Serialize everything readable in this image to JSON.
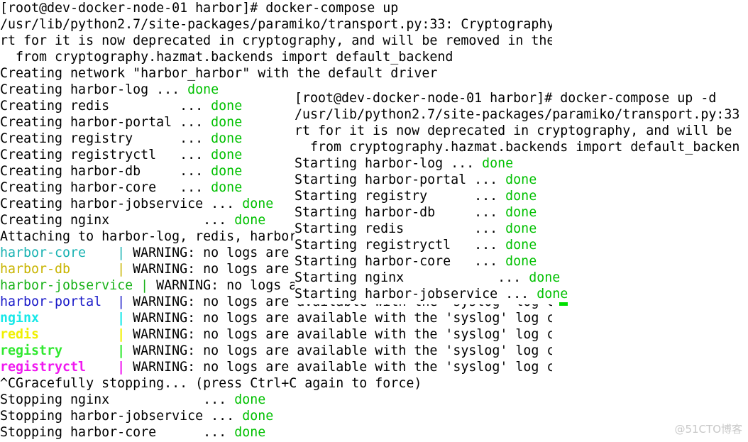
{
  "colors": {
    "default": "#000000",
    "done": "#00c000",
    "harbor-core": "#18b2b2",
    "harbor-db": "#c8b400",
    "harbor-jobservice": "#18b218",
    "harbor-portal": "#1818c8",
    "nginx": "#18e8e8",
    "redis": "#f0f000",
    "registry": "#30e830",
    "registryctl": "#f018f0"
  },
  "left_terminal": {
    "lines": [
      [
        {
          "t": "[root@dev-docker-node-01 harbor]# docker-compose up"
        }
      ],
      [
        {
          "t": "/usr/lib/python2.7/site-packages/paramiko/transport.py:33: Cryptography"
        }
      ],
      [
        {
          "t": "rt for it is now deprecated in cryptography, and will be removed in the"
        }
      ],
      [
        {
          "t": "  from cryptography.hazmat.backends import default_backend"
        }
      ],
      [
        {
          "t": "Creating network \"harbor_harbor\" with the default driver"
        }
      ],
      [
        {
          "t": "Creating harbor-log ... "
        },
        {
          "t": "done",
          "c": "done"
        }
      ],
      [
        {
          "t": "Creating redis         ... "
        },
        {
          "t": "done",
          "c": "done"
        }
      ],
      [
        {
          "t": "Creating harbor-portal ... "
        },
        {
          "t": "done",
          "c": "done"
        }
      ],
      [
        {
          "t": "Creating registry      ... "
        },
        {
          "t": "done",
          "c": "done"
        }
      ],
      [
        {
          "t": "Creating registryctl   ... "
        },
        {
          "t": "done",
          "c": "done"
        }
      ],
      [
        {
          "t": "Creating harbor-db     ... "
        },
        {
          "t": "done",
          "c": "done"
        }
      ],
      [
        {
          "t": "Creating harbor-core   ... "
        },
        {
          "t": "done",
          "c": "done"
        }
      ],
      [
        {
          "t": "Creating harbor-jobservice ... "
        },
        {
          "t": "done",
          "c": "done"
        }
      ],
      [
        {
          "t": "Creating nginx            ... "
        },
        {
          "t": "done",
          "c": "done"
        }
      ],
      [
        {
          "t": "Attaching to harbor-log, redis, harbor"
        }
      ],
      [
        {
          "t": "harbor-core    | ",
          "c": "harbor-core"
        },
        {
          "t": "WARNING: no logs are"
        }
      ],
      [
        {
          "t": "harbor-db      | ",
          "c": "harbor-db"
        },
        {
          "t": "WARNING: no logs are"
        }
      ],
      [
        {
          "t": "harbor-jobservice | ",
          "c": "harbor-jobservice"
        },
        {
          "t": "WARNING: no logs a"
        }
      ],
      [
        {
          "t": "harbor-portal  | ",
          "c": "harbor-portal"
        },
        {
          "t": "WARNING: no logs are available with the 'syslog' log c"
        }
      ],
      [
        {
          "t": "nginx          | ",
          "c": "nginx",
          "b": true
        },
        {
          "t": "WARNING: no logs are available with the 'syslog' log c"
        }
      ],
      [
        {
          "t": "redis          | ",
          "c": "redis",
          "b": true
        },
        {
          "t": "WARNING: no logs are available with the 'syslog' log c"
        }
      ],
      [
        {
          "t": "registry       | ",
          "c": "registry",
          "b": true
        },
        {
          "t": "WARNING: no logs are available with the 'syslog' log c"
        }
      ],
      [
        {
          "t": "registryctl    | ",
          "c": "registryctl",
          "b": true
        },
        {
          "t": "WARNING: no logs are available with the 'syslog' log c"
        }
      ],
      [
        {
          "t": "^CGracefully stopping... (press Ctrl+C again to force)"
        }
      ],
      [
        {
          "t": "Stopping nginx            ... "
        },
        {
          "t": "done",
          "c": "done"
        }
      ],
      [
        {
          "t": "Stopping harbor-jobservice ... "
        },
        {
          "t": "done",
          "c": "done"
        }
      ],
      [
        {
          "t": "Stopping harbor-core      ... "
        },
        {
          "t": "done",
          "c": "done"
        }
      ]
    ]
  },
  "right_terminal": {
    "lines": [
      [
        {
          "t": "[root@dev-docker-node-01 harbor]# docker-compose up -d"
        }
      ],
      [
        {
          "t": "/usr/lib/python2.7/site-packages/paramiko/transport.py:33"
        }
      ],
      [
        {
          "t": "rt for it is now deprecated in cryptography, and will be"
        }
      ],
      [
        {
          "t": "  from cryptography.hazmat.backends import default_backen"
        }
      ],
      [
        {
          "t": "Starting harbor-log ... "
        },
        {
          "t": "done",
          "c": "done"
        }
      ],
      [
        {
          "t": "Starting harbor-portal ... "
        },
        {
          "t": "done",
          "c": "done"
        }
      ],
      [
        {
          "t": "Starting registry      ... "
        },
        {
          "t": "done",
          "c": "done"
        }
      ],
      [
        {
          "t": "Starting harbor-db     ... "
        },
        {
          "t": "done",
          "c": "done"
        }
      ],
      [
        {
          "t": "Starting redis         ... "
        },
        {
          "t": "done",
          "c": "done"
        }
      ],
      [
        {
          "t": "Starting registryctl   ... "
        },
        {
          "t": "done",
          "c": "done"
        }
      ],
      [
        {
          "t": "Starting harbor-core   ... "
        },
        {
          "t": "done",
          "c": "done"
        }
      ],
      [
        {
          "t": "Starting nginx            ... "
        },
        {
          "t": "done",
          "c": "done"
        }
      ],
      [
        {
          "t": "Starting harbor-jobservice ... "
        },
        {
          "t": "done",
          "c": "done"
        }
      ]
    ]
  },
  "watermark": "@51CTO博客"
}
